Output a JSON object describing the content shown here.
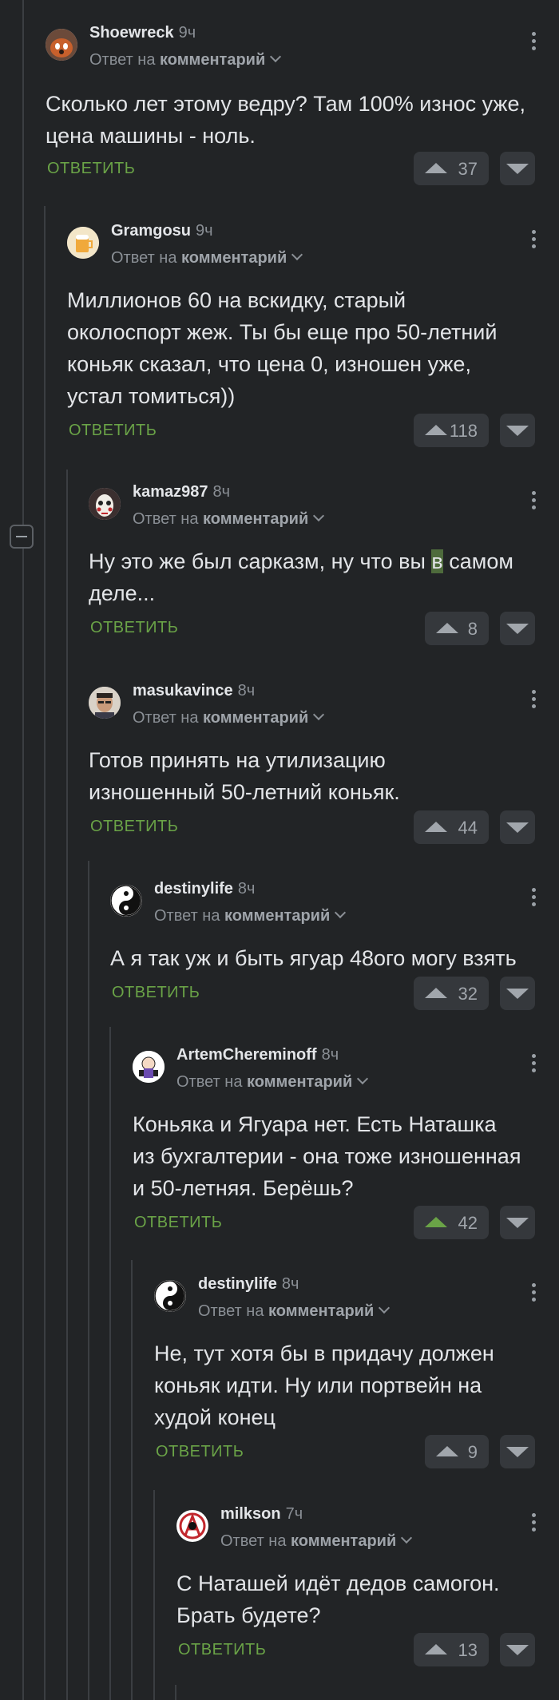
{
  "ui": {
    "reply_to_prefix": "Ответ на",
    "reply_to_target": "комментарий",
    "reply_label": "ОТВЕТИТЬ"
  },
  "comments": [
    {
      "user": "Shoewreck",
      "time": "9ч",
      "lines": [
        "Сколько лет этому ведру? Там 100% износ уже,",
        "цена машины - ноль."
      ],
      "votes": "37",
      "avatar": "red-panda-avatar"
    },
    {
      "user": "Gramgosu",
      "time": "9ч",
      "lines": [
        "Миллионов 60 на вскидку, старый",
        "околоспорт жеж. Ты бы еще про 50-летний",
        "коньяк сказал, что цена 0, изношен уже,",
        "устал томиться))"
      ],
      "votes": "118",
      "avatar": "beer-avatar"
    },
    {
      "user": "kamaz987",
      "time": "8ч",
      "text_a": "Ну это же был сарказм, ну что вы ",
      "text_hl": "в",
      "text_b": " самом",
      "line2": "деле...",
      "votes": "8",
      "avatar": "mask-avatar"
    },
    {
      "user": "masukavince",
      "time": "8ч",
      "lines": [
        "Готов принять на утилизацию",
        "изношенный 50-летний коньяк."
      ],
      "votes": "44",
      "avatar": "man-avatar"
    },
    {
      "user": "destinylife",
      "time": "8ч",
      "lines": [
        "А я так уж и быть ягуар 48ого могу взять"
      ],
      "votes": "32",
      "avatar": "yinyang-avatar"
    },
    {
      "user": "ArtemChereminoff",
      "time": "8ч",
      "lines": [
        "Коньяка и Ягуара нет. Есть Наташка",
        "из бухгалтерии - она тоже изношенная",
        "и 50-летняя. Берёшь?"
      ],
      "votes": "42",
      "avatar": "cartoon-avatar"
    },
    {
      "user": "destinylife",
      "time": "8ч",
      "lines": [
        "Не, тут хотя бы в придачу должен",
        "коньяк идти. Ну или портвейн на",
        "худой конец"
      ],
      "votes": "9",
      "avatar": "yinyang-avatar"
    },
    {
      "user": "milkson",
      "time": "7ч",
      "lines": [
        "С Наташей идёт дедов самогон.",
        "Брать будете?"
      ],
      "votes": "13",
      "avatar": "anarchy-avatar"
    }
  ],
  "colors": {
    "accent": "#6aa347",
    "background": "#222426",
    "button": "#35383c"
  }
}
